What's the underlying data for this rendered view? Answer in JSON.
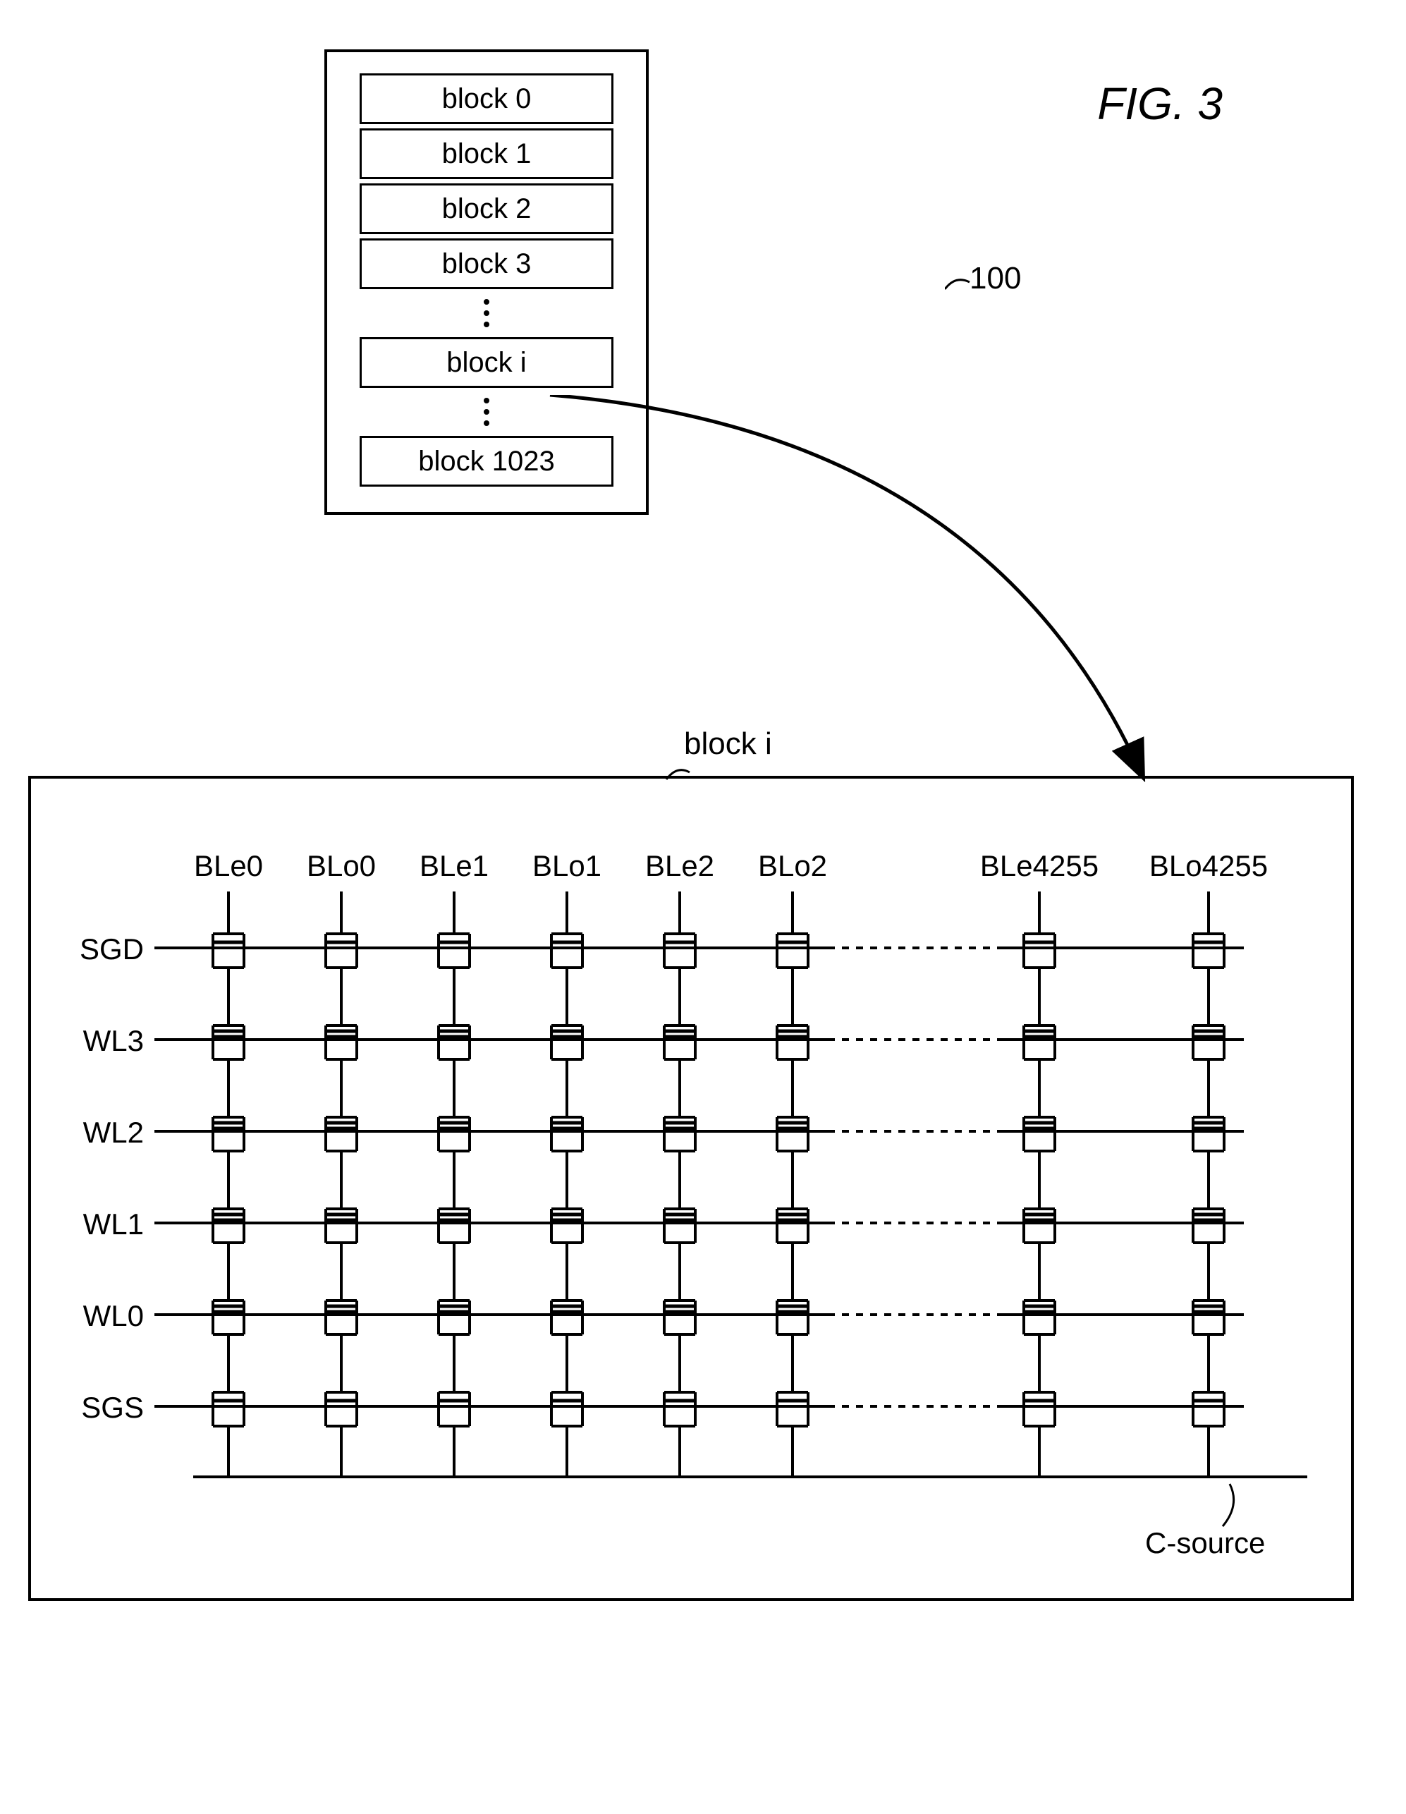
{
  "figure_title": "FIG. 3",
  "array_ref": "100",
  "blocks": {
    "b0": "block 0",
    "b1": "block 1",
    "b2": "block 2",
    "b3": "block 3",
    "bi": "block i",
    "blast": "block 1023"
  },
  "detail_title": "block i",
  "row_labels": {
    "sgd": "SGD",
    "wl3": "WL3",
    "wl2": "WL2",
    "wl1": "WL1",
    "wl0": "WL0",
    "sgs": "SGS"
  },
  "col_labels": {
    "c0": "BLe0",
    "c1": "BLo0",
    "c2": "BLe1",
    "c3": "BLo1",
    "c4": "BLe2",
    "c5": "BLo2",
    "c6": "BLe4255",
    "c7": "BLo4255"
  },
  "csource": "C-source"
}
